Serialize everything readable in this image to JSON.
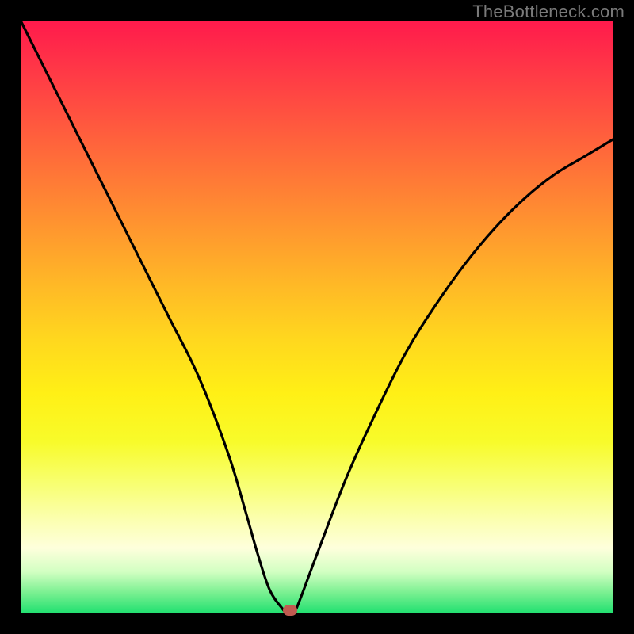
{
  "watermark": "TheBottleneck.com",
  "colors": {
    "frame": "#000000",
    "curve": "#000000",
    "marker": "#c05a50"
  },
  "chart_data": {
    "type": "line",
    "title": "",
    "xlabel": "",
    "ylabel": "",
    "xlim": [
      0,
      100
    ],
    "ylim": [
      0,
      100
    ],
    "grid": false,
    "legend": false,
    "series": [
      {
        "name": "bottleneck-curve",
        "x": [
          0,
          5,
          10,
          15,
          20,
          25,
          30,
          35,
          38,
          40,
          42,
          44,
          45,
          46,
          47,
          50,
          55,
          60,
          65,
          70,
          75,
          80,
          85,
          90,
          95,
          100
        ],
        "y": [
          100,
          90,
          80,
          70,
          60,
          50,
          40,
          27,
          17,
          10,
          4,
          1,
          0,
          0,
          2,
          10,
          23,
          34,
          44,
          52,
          59,
          65,
          70,
          74,
          77,
          80
        ]
      }
    ],
    "marker": {
      "x": 45.5,
      "y": 0
    },
    "background_gradient": {
      "stops": [
        {
          "pos": 0.0,
          "color": "#ff1a4c"
        },
        {
          "pos": 0.5,
          "color": "#ffd81e"
        },
        {
          "pos": 0.85,
          "color": "#fbffae"
        },
        {
          "pos": 1.0,
          "color": "#20e070"
        }
      ]
    }
  }
}
